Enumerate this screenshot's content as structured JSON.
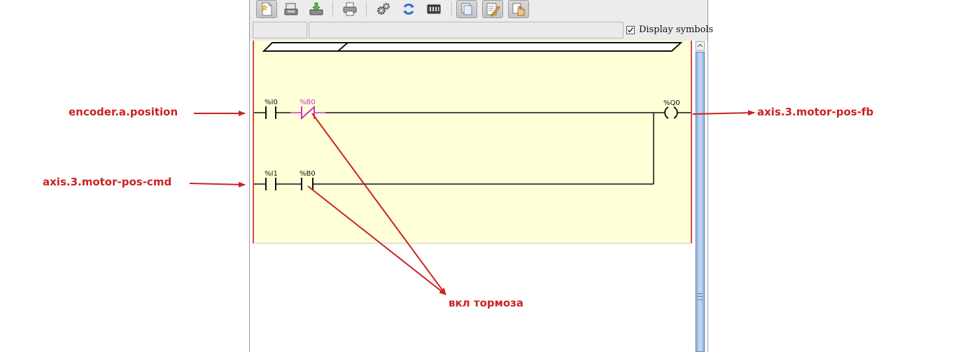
{
  "toolbar": {
    "buttons": [
      {
        "name": "new-icon",
        "pressed": true
      },
      {
        "name": "open-icon",
        "pressed": false
      },
      {
        "name": "save-icon",
        "pressed": false
      },
      {
        "name": "print-icon",
        "pressed": false
      },
      {
        "name": "settings-icon",
        "pressed": false
      },
      {
        "name": "refresh-icon",
        "pressed": false
      },
      {
        "name": "io-config-icon",
        "pressed": false
      },
      {
        "name": "sections-icon",
        "pressed": true
      },
      {
        "name": "edit-icon",
        "pressed": true
      },
      {
        "name": "hand-icon",
        "pressed": true
      }
    ]
  },
  "rung_bar": {
    "label_value": "",
    "comment_value": "",
    "display_symbols_label": "Display symbols",
    "display_symbols_checked": true
  },
  "ladder": {
    "rung1": {
      "contact1": {
        "label": "%I0",
        "type": "normally-open"
      },
      "contact2": {
        "label": "%B0",
        "type": "normally-closed",
        "highlighted": true
      },
      "coil": {
        "label": "%Q0"
      }
    },
    "rung2": {
      "contact1": {
        "label": "%I1",
        "type": "normally-open"
      },
      "contact2": {
        "label": "%B0",
        "type": "normally-open"
      }
    }
  },
  "annotations": {
    "input0": "encoder.a.position",
    "input1": "axis.3.motor-pos-cmd",
    "output": "axis.3.motor-pos-fb",
    "brake": "вкл тормоза"
  },
  "colors": {
    "annotation": "#cc2222",
    "highlight": "#cc33cc",
    "ladder_bg": "#ffffd8",
    "power_rail": "#d64848"
  }
}
